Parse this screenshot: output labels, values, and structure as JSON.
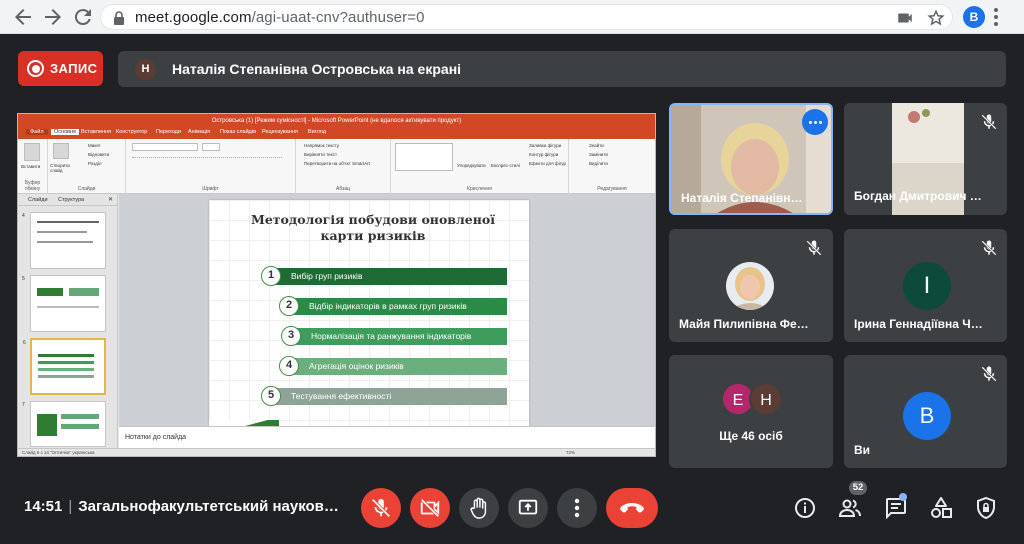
{
  "browser": {
    "url_host": "meet.google.com",
    "url_path": "/agi-uaat-cnv?authuser=0",
    "profile_initial": "B"
  },
  "recording": {
    "label": "ЗАПИС",
    "color": "#d93025"
  },
  "presenter": {
    "initial": "Н",
    "text": "Наталія Степанівна Островська на екрані"
  },
  "shared_screen": {
    "titlebar": "Островська (1) [Режим сумісності] - Microsoft PowerPoint (не вдалося активувати продукт)",
    "tabs": [
      "Файл",
      "Основне",
      "Вставлення",
      "Конструктор",
      "Переходи",
      "Анімація",
      "Показ слайдів",
      "Рецензування",
      "Вигляд"
    ],
    "groups": [
      "Буфер обміну",
      "Слайди",
      "Шрифт",
      "Абзац",
      "Креслення",
      "Редагування"
    ],
    "ribbon_labels": {
      "paste": "Вставити",
      "new_slide": "Створити слайд",
      "layout": "Макет",
      "reset": "Відновити",
      "section": "Розділ",
      "text_direction": "Напрямок тексту",
      "align_text": "Вирівняти текст",
      "smartart": "Перетворити на об'єкт SmartArt",
      "arrange": "Упорядкувати",
      "quick_styles": "Експрес-стилі",
      "shape_fill": "Заливка фігури",
      "shape_outline": "Контур фігури",
      "shape_effects": "Ефекти для фігур",
      "find": "Знайти",
      "replace": "Замінити",
      "select": "Виділити"
    },
    "thumb_tabs": [
      "Слайди",
      "Структура"
    ],
    "thumb_numbers": [
      "4",
      "5",
      "6",
      "7"
    ],
    "slide": {
      "title": "Методологія побудови оновленої карти ризиків",
      "steps": [
        {
          "n": "1",
          "text": "Вибір груп ризиків",
          "color": "#1e6b34"
        },
        {
          "n": "2",
          "text": "Відбір індикаторів в рамках груп ризиків",
          "color": "#2b8a45"
        },
        {
          "n": "3",
          "text": "Нормалізація та ранжування індикаторів",
          "color": "#3e9c5c"
        },
        {
          "n": "4",
          "text": "Агрегація оцінок ризиків",
          "color": "#6aaf7c"
        },
        {
          "n": "5",
          "text": "Тестування ефективності",
          "color": "#8fa497"
        }
      ]
    },
    "notes": "Нотатки до слайда",
    "status": {
      "left": "Слайд 6 з 14   \"Оптична\"   українська",
      "zoom": "72%"
    }
  },
  "participants": [
    {
      "name": "Наталія Степанівн…",
      "speaking": true,
      "more_button": "more-options"
    },
    {
      "name": "Богдан Дмитрович …",
      "muted": true
    },
    {
      "name": "Майя Пилипівна Фе…",
      "muted": true
    },
    {
      "name": "Ірина Геннадіївна Ч…",
      "muted": true,
      "initial": "І",
      "avatar_color": "#0d4a3a"
    },
    {
      "name": "Ще 46 осіб",
      "avatars": [
        {
          "initial": "Е",
          "color": "#b5266b"
        },
        {
          "initial": "Н",
          "color": "#5b3d36"
        }
      ]
    },
    {
      "name": "Ви",
      "muted": true,
      "initial": "B",
      "avatar_color": "#1a73e8"
    }
  ],
  "bottombar": {
    "time": "14:51",
    "separator": "|",
    "meeting_title": "Загальнофакультетський науков…",
    "participant_count": "52",
    "colors": {
      "mic_off": "#ea4335",
      "end_call": "#ea4335",
      "neutral": "#3c4043"
    }
  }
}
